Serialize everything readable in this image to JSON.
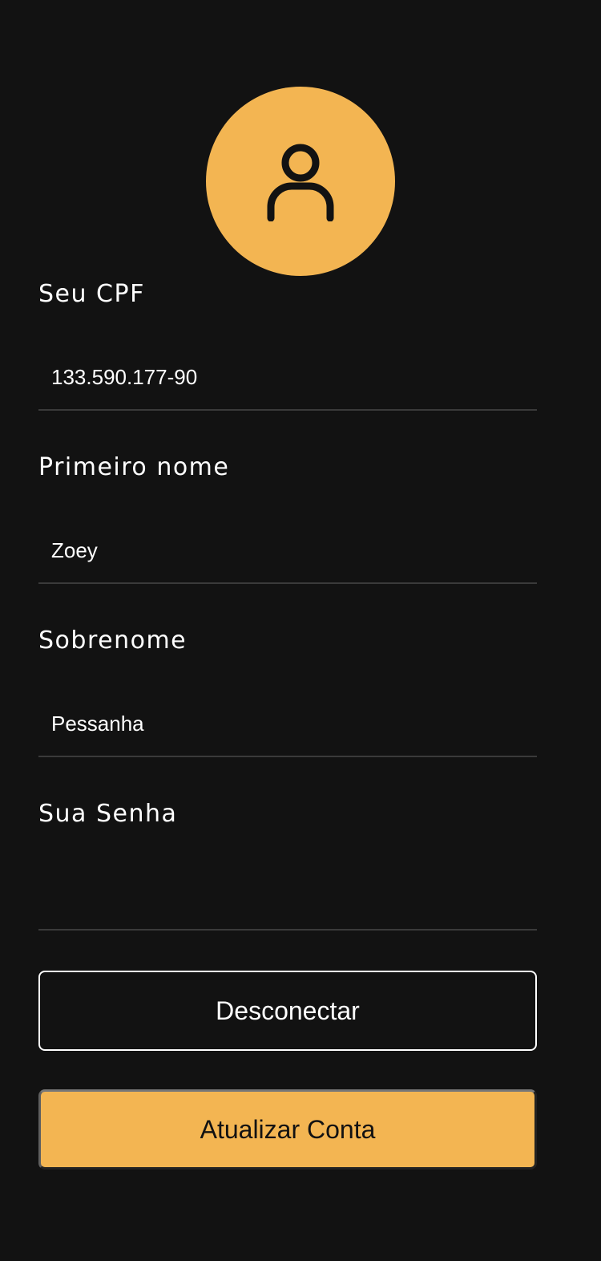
{
  "avatar": {
    "icon": "user-icon",
    "color": "#F3B552"
  },
  "fields": {
    "cpf": {
      "label": "Seu CPF",
      "value": "133.590.177-90"
    },
    "first_name": {
      "label": "Primeiro nome",
      "value": "Zoey"
    },
    "last_name": {
      "label": "Sobrenome",
      "value": "Pessanha"
    },
    "password": {
      "label": "Sua Senha",
      "value": ""
    }
  },
  "buttons": {
    "logout_label": "Desconectar",
    "update_label": "Atualizar Conta"
  },
  "colors": {
    "background": "#121212",
    "accent": "#F3B552",
    "text": "#FFFFFF"
  }
}
